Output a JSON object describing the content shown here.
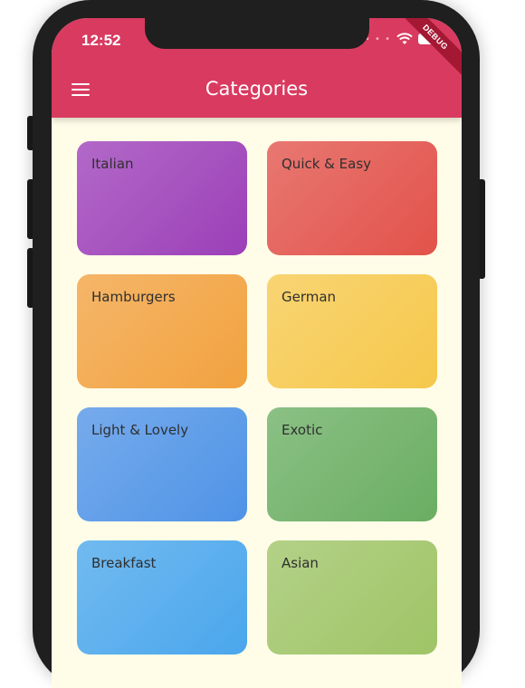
{
  "status_bar": {
    "time": "12:52",
    "debug_banner": "DEBUG"
  },
  "appbar": {
    "title": "Categories",
    "menu_icon": "hamburger-menu-icon",
    "color": "#d93a60"
  },
  "background_color": "#fffde8",
  "categories": [
    {
      "title": "Italian",
      "color": "#9c3fb8"
    },
    {
      "title": "Quick & Easy",
      "color": "#e2524a"
    },
    {
      "title": "Hamburgers",
      "color": "#f2a23f"
    },
    {
      "title": "German",
      "color": "#f6c84b"
    },
    {
      "title": "Light & Lovely",
      "color": "#4f93e6"
    },
    {
      "title": "Exotic",
      "color": "#6aae62"
    },
    {
      "title": "Breakfast",
      "color": "#4aa6ec"
    },
    {
      "title": "Asian",
      "color": "#9fc466"
    }
  ]
}
